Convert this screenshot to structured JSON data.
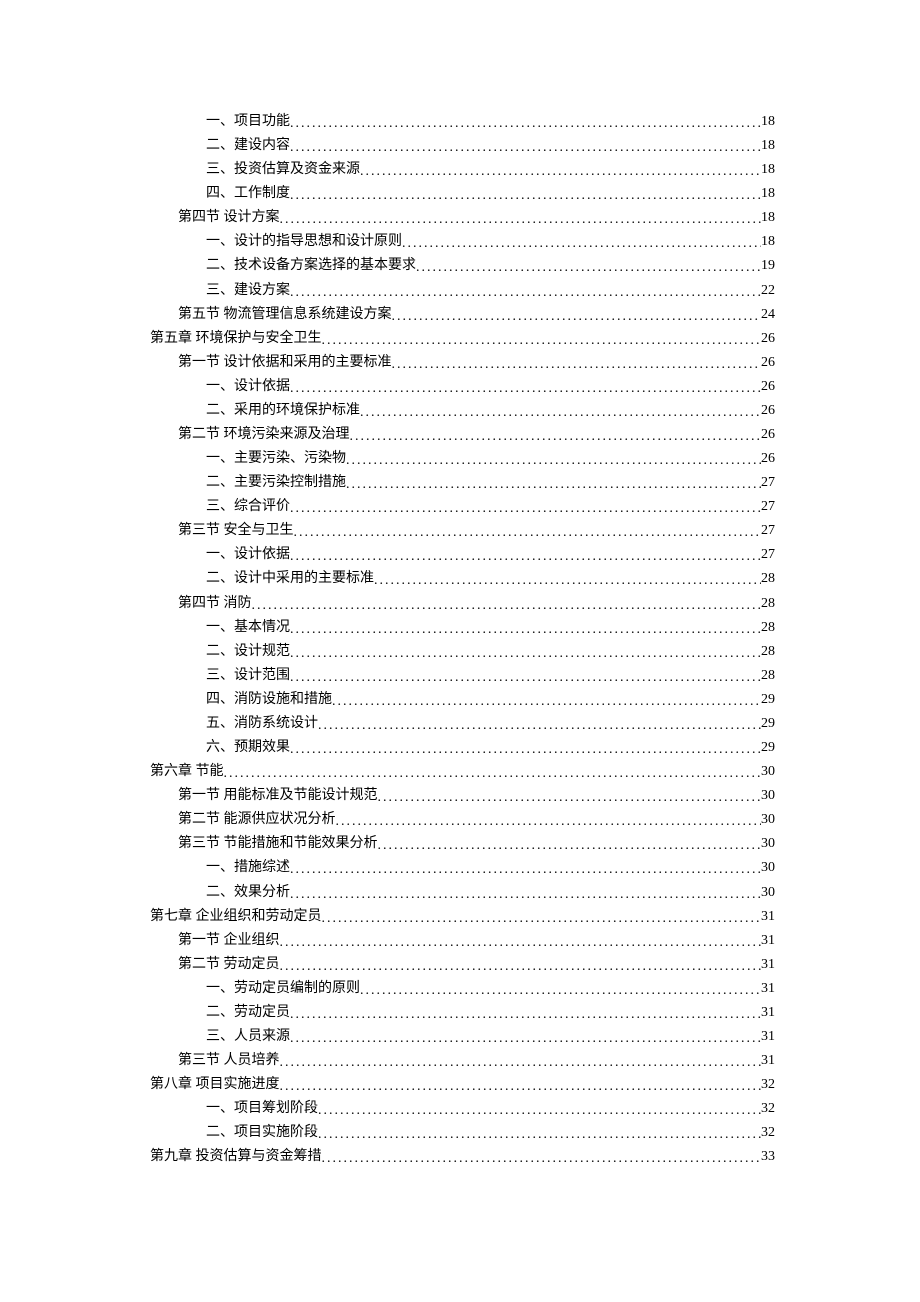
{
  "toc": [
    {
      "level": 3,
      "title": "一、项目功能",
      "page": "18"
    },
    {
      "level": 3,
      "title": "二、建设内容",
      "page": "18"
    },
    {
      "level": 3,
      "title": "三、投资估算及资金来源",
      "page": "18"
    },
    {
      "level": 3,
      "title": "四、工作制度",
      "page": "18"
    },
    {
      "level": 2,
      "title": "第四节  设计方案",
      "page": "18"
    },
    {
      "level": 3,
      "title": "一、设计的指导思想和设计原则",
      "page": "18"
    },
    {
      "level": 3,
      "title": "二、技术设备方案选择的基本要求",
      "page": "19"
    },
    {
      "level": 3,
      "title": "三、建设方案",
      "page": "22"
    },
    {
      "level": 2,
      "title": "第五节  物流管理信息系统建设方案",
      "page": "24"
    },
    {
      "level": 1,
      "title": "第五章  环境保护与安全卫生",
      "page": "26"
    },
    {
      "level": 2,
      "title": "第一节  设计依据和采用的主要标准",
      "page": "26"
    },
    {
      "level": 3,
      "title": "一、设计依据",
      "page": "26"
    },
    {
      "level": 3,
      "title": "二、采用的环境保护标准",
      "page": "26"
    },
    {
      "level": 2,
      "title": "第二节  环境污染来源及治理",
      "page": "26"
    },
    {
      "level": 3,
      "title": "一、主要污染、污染物",
      "page": "26"
    },
    {
      "level": 3,
      "title": "二、主要污染控制措施",
      "page": "27"
    },
    {
      "level": 3,
      "title": "三、综合评价",
      "page": "27"
    },
    {
      "level": 2,
      "title": "第三节  安全与卫生",
      "page": "27"
    },
    {
      "level": 3,
      "title": "一、设计依据",
      "page": "27"
    },
    {
      "level": 3,
      "title": "二、设计中采用的主要标准",
      "page": "28"
    },
    {
      "level": 2,
      "title": "第四节  消防",
      "page": "28"
    },
    {
      "level": 3,
      "title": "一、基本情况",
      "page": "28"
    },
    {
      "level": 3,
      "title": "二、设计规范",
      "page": "28"
    },
    {
      "level": 3,
      "title": "三、设计范围",
      "page": "28"
    },
    {
      "level": 3,
      "title": "四、消防设施和措施",
      "page": "29"
    },
    {
      "level": 3,
      "title": "五、消防系统设计",
      "page": "29"
    },
    {
      "level": 3,
      "title": "六、预期效果",
      "page": "29"
    },
    {
      "level": 1,
      "title": "第六章  节能",
      "page": "30"
    },
    {
      "level": 2,
      "title": "第一节  用能标准及节能设计规范",
      "page": "30"
    },
    {
      "level": 2,
      "title": "第二节  能源供应状况分析",
      "page": "30"
    },
    {
      "level": 2,
      "title": "第三节  节能措施和节能效果分析",
      "page": "30"
    },
    {
      "level": 3,
      "title": "一、措施综述",
      "page": "30"
    },
    {
      "level": 3,
      "title": "二、效果分析",
      "page": "30"
    },
    {
      "level": 1,
      "title": "第七章  企业组织和劳动定员",
      "page": "31"
    },
    {
      "level": 2,
      "title": "第一节  企业组织",
      "page": "31"
    },
    {
      "level": 2,
      "title": "第二节  劳动定员",
      "page": "31"
    },
    {
      "level": 3,
      "title": "一、劳动定员编制的原则",
      "page": "31"
    },
    {
      "level": 3,
      "title": "二、劳动定员",
      "page": "31"
    },
    {
      "level": 3,
      "title": "三、人员来源",
      "page": "31"
    },
    {
      "level": 2,
      "title": "第三节  人员培养",
      "page": "31"
    },
    {
      "level": 1,
      "title": "第八章  项目实施进度",
      "page": "32"
    },
    {
      "level": 3,
      "title": "一、项目筹划阶段",
      "page": "32"
    },
    {
      "level": 3,
      "title": "二、项目实施阶段",
      "page": "32"
    },
    {
      "level": 1,
      "title": "第九章  投资估算与资金筹措",
      "page": "33"
    }
  ]
}
